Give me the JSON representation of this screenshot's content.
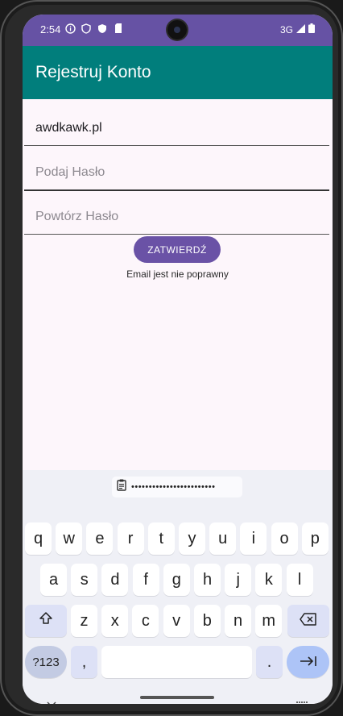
{
  "status": {
    "time": "2:54",
    "network": "3G"
  },
  "appbar": {
    "title": "Rejestruj Konto"
  },
  "form": {
    "email_value": "awdkawk.pl",
    "password_placeholder": "Podaj Hasło",
    "repeat_placeholder": "Powtórz Hasło",
    "submit_label": "ZATWIERDŹ",
    "error_text": "Email jest nie poprawny"
  },
  "keyboard": {
    "suggestion": "••••••••••••••••••••••••",
    "row1": [
      "q",
      "w",
      "e",
      "r",
      "t",
      "y",
      "u",
      "i",
      "o",
      "p"
    ],
    "row2": [
      "a",
      "s",
      "d",
      "f",
      "g",
      "h",
      "j",
      "k",
      "l"
    ],
    "row3": [
      "z",
      "x",
      "c",
      "v",
      "b",
      "n",
      "m"
    ],
    "symbols_label": "?123",
    "comma_label": ",",
    "period_label": "."
  },
  "colors": {
    "statusbar": "#6652a4",
    "appbar": "#017e7c",
    "button": "#6a52a6"
  }
}
